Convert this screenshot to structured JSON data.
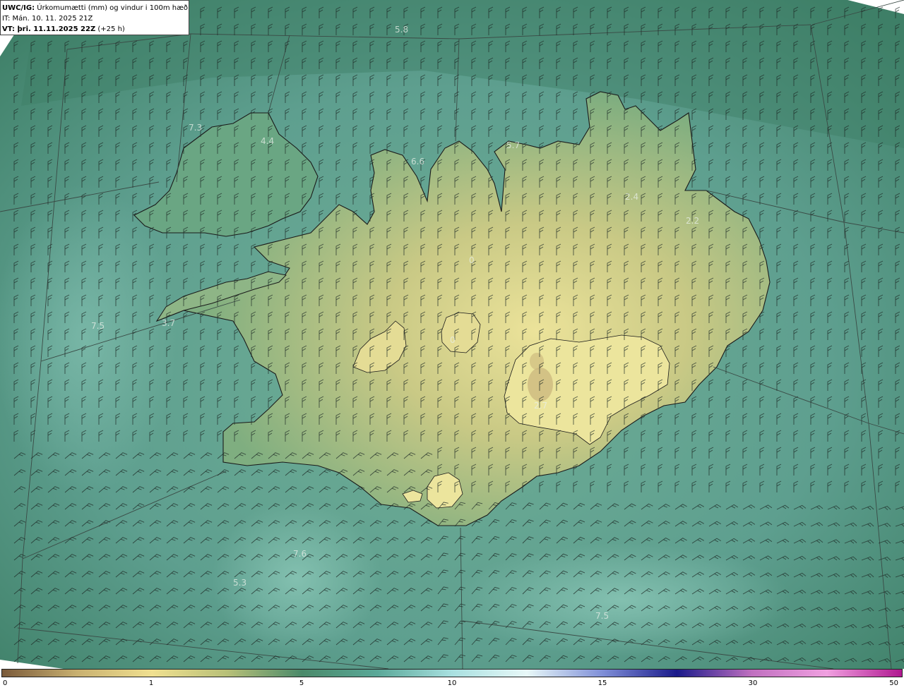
{
  "info": {
    "model_label": "UWC/IG:",
    "title_text": "Úrkomumætti (mm) og vindur i 100m hæð",
    "it_line": "IT: Mán. 10. 11. 2025 21Z",
    "vt_label": "VT: þri. 11.11.2025 22Z",
    "vt_suffix": "(+25 h)"
  },
  "map": {
    "ocean_color": "#5e9f8f",
    "land_color": "#b9c07e",
    "highland_color": "#e2dc8e",
    "coast_color": "#1a1a1a",
    "gridline_color": "#3a4a45",
    "wind_barb_color": "#1d2a26",
    "outside_color": "#ffffff"
  },
  "value_labels": [
    "5.8",
    "7.3",
    "4.4",
    "6.6",
    "5.7",
    "2.4",
    "2.2",
    "7.5",
    "3.7",
    "0",
    "2.7",
    "7.6",
    "5.3",
    "7.5",
    "0"
  ],
  "legend": {
    "ticks": [
      "0",
      "1",
      "5",
      "10",
      "15",
      "30",
      "50"
    ],
    "colors": [
      "#7a5a3a",
      "#c8b070",
      "#f0e090",
      "#b8c078",
      "#4a8a6a",
      "#5aa898",
      "#a8e0e0",
      "#e8f8f8",
      "#8090d8",
      "#1a1a8a",
      "#c070c0",
      "#f0a0e0",
      "#b01890"
    ]
  }
}
